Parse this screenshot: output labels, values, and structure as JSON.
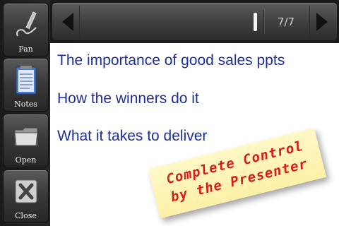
{
  "sidebar": {
    "items": [
      {
        "label": "Pan",
        "icon": "pen-icon"
      },
      {
        "label": "Notes",
        "icon": "notepad-icon"
      },
      {
        "label": "Open",
        "icon": "folder-icon"
      },
      {
        "label": "Close",
        "icon": "close-icon"
      }
    ]
  },
  "toolbar": {
    "page_indicator": "7/7",
    "prev_icon": "triangle-left-icon",
    "next_icon": "triangle-right-icon"
  },
  "slide": {
    "bullets": [
      "The importance of good sales ppts",
      "How the winners do it",
      "What it takes to deliver"
    ],
    "note": {
      "line1": "Complete Control",
      "line2": "by the Presenter"
    }
  },
  "colors": {
    "bullet_text": "#1f2f9a",
    "note_text": "#d41e1e",
    "note_background": "#fff4b8"
  }
}
